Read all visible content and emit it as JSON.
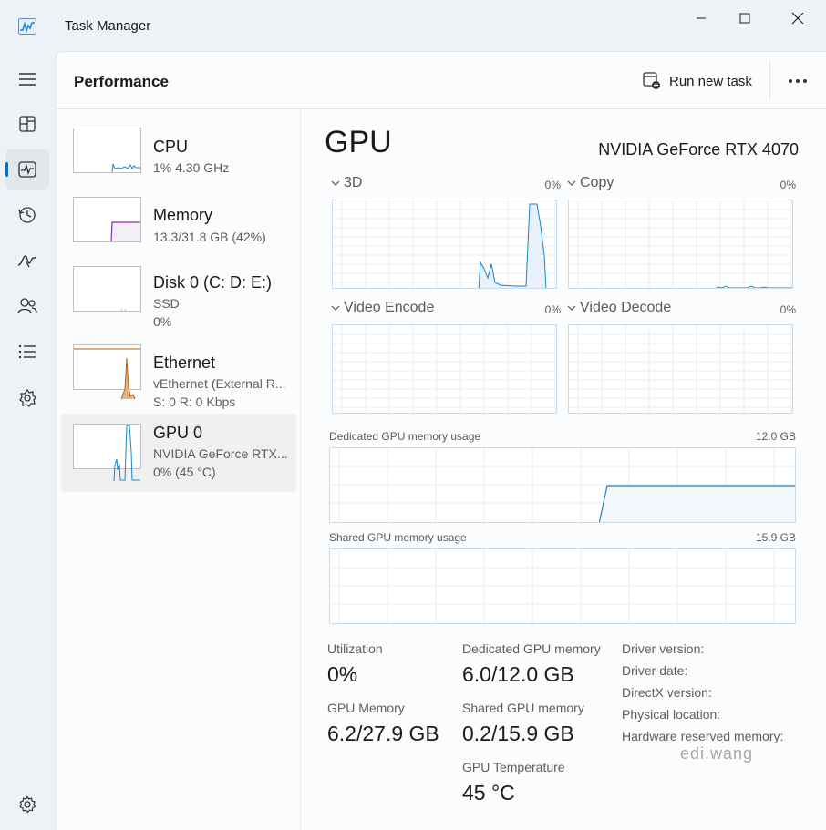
{
  "window": {
    "title": "Task Manager",
    "controls": [
      "minimize",
      "maximize",
      "close"
    ]
  },
  "nav": {
    "items": [
      {
        "name": "hamburger-icon"
      },
      {
        "name": "processes-icon"
      },
      {
        "name": "performance-icon",
        "active": true
      },
      {
        "name": "app-history-icon"
      },
      {
        "name": "startup-apps-icon"
      },
      {
        "name": "users-icon"
      },
      {
        "name": "details-icon"
      },
      {
        "name": "services-icon"
      },
      {
        "name": "settings-icon"
      }
    ]
  },
  "header": {
    "title": "Performance",
    "run_task_label": "Run new task"
  },
  "sidebar": {
    "items": [
      {
        "name": "CPU",
        "line1": "1%  4.30 GHz",
        "line2": ""
      },
      {
        "name": "Memory",
        "line1": "13.3/31.8 GB (42%)",
        "line2": ""
      },
      {
        "name": "Disk 0 (C: D: E:)",
        "line1": "SSD",
        "line2": "0%"
      },
      {
        "name": "Ethernet",
        "line1": "vEthernet (External R...",
        "line2": "S: 0 R: 0 Kbps"
      },
      {
        "name": "GPU 0",
        "line1": "NVIDIA GeForce RTX...",
        "line2": "0%  (45 °C)",
        "selected": true
      }
    ]
  },
  "gpu": {
    "title": "GPU",
    "model": "NVIDIA GeForce RTX 4070",
    "engines": [
      {
        "label": "3D",
        "pct": "0%"
      },
      {
        "label": "Copy",
        "pct": "0%"
      },
      {
        "label": "Video Encode",
        "pct": "0%"
      },
      {
        "label": "Video Decode",
        "pct": "0%"
      }
    ],
    "dedicated_graph": {
      "label": "Dedicated GPU memory usage",
      "max": "12.0 GB"
    },
    "shared_graph": {
      "label": "Shared GPU memory usage",
      "max": "15.9 GB"
    },
    "stats": {
      "utilization_label": "Utilization",
      "utilization_value": "0%",
      "dedicated_label": "Dedicated GPU memory",
      "dedicated_value": "6.0/12.0 GB",
      "gpu_memory_label": "GPU Memory",
      "gpu_memory_value": "6.2/27.9 GB",
      "shared_label": "Shared GPU memory",
      "shared_value": "0.2/15.9 GB",
      "temp_label": "GPU Temperature",
      "temp_value": "45 °C"
    },
    "info_labels": [
      "Driver version:",
      "Driver date:",
      "DirectX version:",
      "Physical location:",
      "Hardware reserved memory:"
    ]
  },
  "watermark": "edi.wang",
  "colors": {
    "gpu_line": "#1a86c8",
    "gpu_fill": "#e8f1f9",
    "memory_line": "#8b2fa8",
    "ethernet_line": "#b8620d",
    "selection_bg": "#f0f0f0",
    "accent": "#0f6cbd"
  }
}
